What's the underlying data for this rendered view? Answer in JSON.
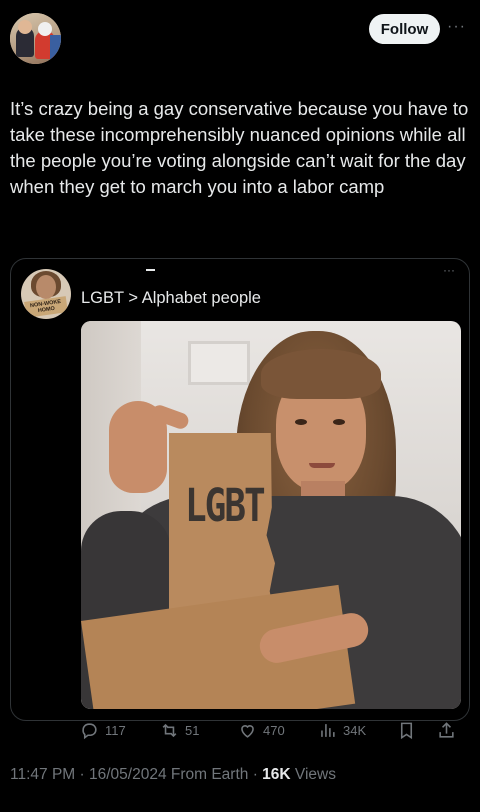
{
  "header": {
    "follow_label": "Follow",
    "more_label": "···"
  },
  "tweet": {
    "text": "It’s crazy being a gay conservative because you have to take these incomprehensibly nuanced opinions while all the people you’re voting alongside can’t wait for the day when they get to march you into a labor camp"
  },
  "quote": {
    "avatar_sign_text": "NON-WOKE HOMO",
    "text": "LGBT > Alphabet people",
    "more_label": "···",
    "image": {
      "card_text": "LGBT"
    }
  },
  "actions": {
    "reply_count": "117",
    "retweet_count": "51",
    "like_count": "470",
    "views_count": "34K"
  },
  "meta": {
    "time": "11:47 PM",
    "date": "16/05/2024",
    "location": "From Earth",
    "views": "16K",
    "views_label": "Views"
  },
  "colors": {
    "background": "#000000",
    "text": "#e7e9ea",
    "muted": "#71767b",
    "border": "#2f3336",
    "follow_bg": "#eff3f4"
  }
}
